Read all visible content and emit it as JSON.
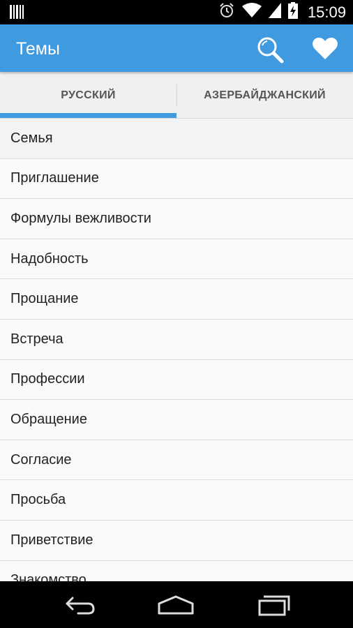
{
  "status_bar": {
    "time": "15:09",
    "icons": [
      "barcode-icon",
      "alarm-icon",
      "wifi-icon",
      "signal-icon",
      "battery-charging-icon"
    ]
  },
  "app_bar": {
    "title": "Темы",
    "background": "#3f9ae0",
    "actions": [
      "search-icon",
      "heart-icon"
    ]
  },
  "tabs": [
    {
      "label": "РУССКИЙ",
      "selected": true
    },
    {
      "label": "АЗЕРБАЙДЖАНСКИЙ",
      "selected": false
    }
  ],
  "topics": [
    "Семья",
    "Приглашение",
    "Формулы вежливости",
    "Надобность",
    "Прощание",
    "Встреча",
    "Профессии",
    "Обращение",
    "Согласие",
    "Просьба",
    "Приветствие",
    "Знакомство"
  ],
  "nav_bar": [
    "back-icon",
    "home-icon",
    "recent-apps-icon"
  ]
}
